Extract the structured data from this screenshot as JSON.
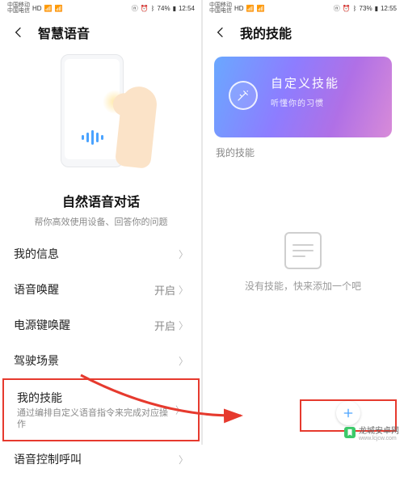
{
  "left": {
    "status": {
      "carrier1": "中国移动",
      "carrier2": "中国电信",
      "hd": "HD",
      "battery": "74%",
      "time": "12:54"
    },
    "title": "智慧语音",
    "hero_title": "自然语音对话",
    "hero_sub": "帮你高效使用设备、回答你的问题",
    "items": [
      {
        "label": "我的信息",
        "value": ""
      },
      {
        "label": "语音唤醒",
        "value": "开启"
      },
      {
        "label": "电源键唤醒",
        "value": "开启"
      },
      {
        "label": "驾驶场景",
        "value": ""
      },
      {
        "label": "我的技能",
        "sub": "通过编排自定义语音指令来完成对应操作",
        "value": ""
      },
      {
        "label": "语音控制呼叫",
        "value": ""
      }
    ]
  },
  "right": {
    "status": {
      "carrier1": "中国移动",
      "carrier2": "中国电信",
      "hd": "HD",
      "battery": "73%",
      "time": "12:55"
    },
    "title": "我的技能",
    "card_title": "自定义技能",
    "card_sub": "听懂你的习惯",
    "section_label": "我的技能",
    "empty_text": "没有技能，快来添加一个吧"
  },
  "watermark": {
    "name": "龙城安卓网",
    "url": "www.lcjcw.com"
  }
}
